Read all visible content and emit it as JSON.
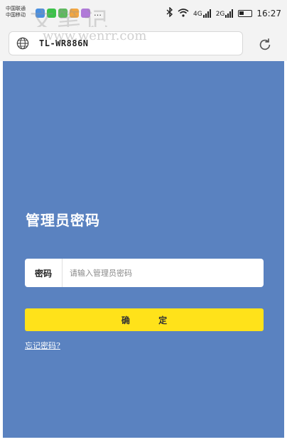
{
  "status_bar": {
    "carrier_1": "中国联通",
    "carrier_2": "中国移动",
    "more": "…",
    "net_4g": "4G",
    "net_2g": "2G",
    "time": "16:27",
    "notification_icon_colors": [
      "#4a8fe0",
      "#3cc24a",
      "#5bbb5b",
      "#f3a640",
      "#b07ad8"
    ]
  },
  "watermark": {
    "text": "文笔记",
    "url": "www.wenrr.com"
  },
  "browser": {
    "url": "TL-WR886N"
  },
  "login": {
    "title": "管理员密码",
    "password_label": "密码",
    "password_placeholder": "请输入管理员密码",
    "password_value": "",
    "confirm_label": "确 定",
    "forgot_link": "忘记密码?"
  },
  "colors": {
    "page_background": "#5a82c0",
    "confirm_button": "#ffe21a",
    "status_bar": "#f3f3f3"
  }
}
